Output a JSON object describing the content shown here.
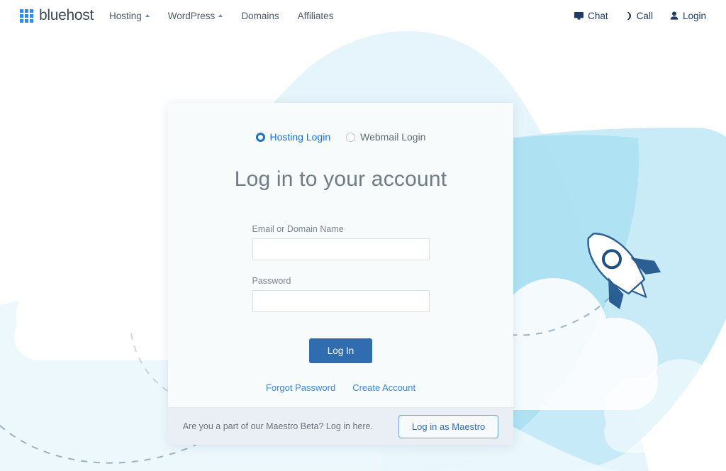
{
  "brand": {
    "name": "bluehost",
    "logo_icon": "grid-squares-icon",
    "logo_color": "#2b8cf5",
    "text_color": "#3b4a56"
  },
  "nav": {
    "left_items": [
      {
        "label": "Hosting",
        "has_caret": true,
        "name": "nav-item-hosting"
      },
      {
        "label": "WordPress",
        "has_caret": true,
        "name": "nav-item-wordpress"
      },
      {
        "label": "Domains",
        "has_caret": false,
        "name": "nav-item-domains"
      },
      {
        "label": "Affiliates",
        "has_caret": false,
        "name": "nav-item-affiliates"
      }
    ],
    "right_items": [
      {
        "label": "Chat",
        "icon": "monitor-icon",
        "name": "nav-item-chat"
      },
      {
        "label": "Call",
        "icon": "phone-icon",
        "name": "nav-item-call"
      },
      {
        "label": "Login",
        "icon": "person-icon",
        "name": "nav-item-login"
      }
    ]
  },
  "login_card": {
    "toggles": [
      {
        "label": "Hosting Login",
        "selected": true
      },
      {
        "label": "Webmail Login",
        "selected": false
      }
    ],
    "title": "Log in to your account",
    "fields": [
      {
        "label": "Email or Domain Name",
        "value": "",
        "placeholder": ""
      },
      {
        "label": "Password",
        "value": "",
        "placeholder": ""
      }
    ],
    "submit_label": "Log In",
    "links": [
      {
        "label": "Forgot Password"
      },
      {
        "label": "Create Account"
      }
    ],
    "footer": {
      "text": "Are you a part of our Maestro Beta? Log in here.",
      "button_label": "Log in as Maestro"
    }
  },
  "decorations": {
    "rocket_icon": "rocket-icon",
    "cloud_icon": "cloud-icon",
    "dashed_trail": "dashed-path",
    "accent_blue": "#2f6cb0",
    "link_blue": "#3d86d6",
    "blob_light": "#dff1fa",
    "blob_mid": "#bde5f5",
    "blob_cyan": "#9fdcef"
  }
}
